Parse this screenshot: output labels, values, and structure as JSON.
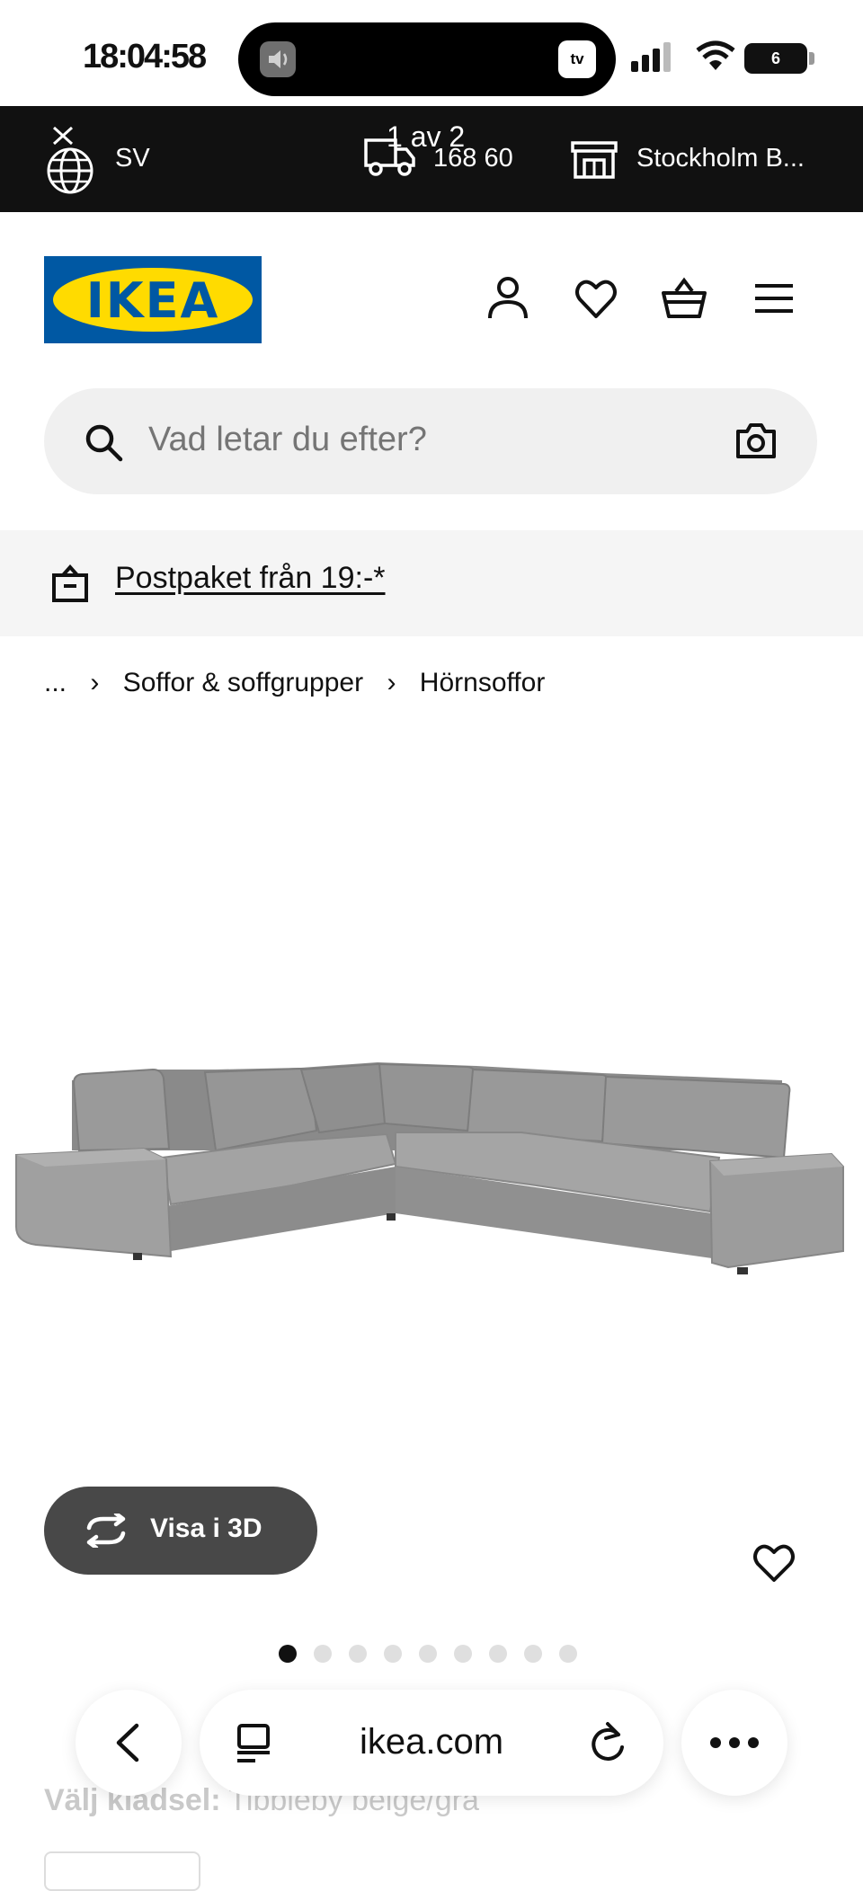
{
  "status_bar": {
    "time": "18:04:58",
    "battery": "6"
  },
  "top_bar": {
    "language": "SV",
    "zip": "168 60",
    "store": "Stockholm B...",
    "page_indicator": "1 av 2"
  },
  "header": {
    "logo_text": "IKEA"
  },
  "search": {
    "placeholder": "Vad letar du efter?"
  },
  "promo": {
    "link_text": "Postpaket från 19:-*"
  },
  "breadcrumb": {
    "ellipsis": "...",
    "items": [
      "Soffor & soffgrupper",
      "Hörnsoffor"
    ]
  },
  "product": {
    "view_3d_label": "Visa i 3D",
    "image_count": 9,
    "active_image_index": 0,
    "choose_fabric_label": "Välj klädsel:",
    "choose_fabric_value": "Tibbleby beige/grå"
  },
  "browser": {
    "url": "ikea.com"
  },
  "icons": {
    "language": "globe-icon",
    "delivery": "truck-icon",
    "store": "store-icon",
    "account": "account-icon",
    "wishlist": "heart-icon",
    "cart": "cart-icon",
    "menu": "hamburger-menu-icon",
    "search": "search-icon",
    "visual_search": "camera-icon",
    "parcel": "parcel-icon",
    "rotate": "rotate-3d-icon",
    "back": "chevron-left-icon",
    "tabs": "tabs-icon",
    "reload": "reload-icon",
    "more": "more-dots-icon"
  },
  "colors": {
    "brand_blue": "#0058a3",
    "brand_yellow": "#ffdb00",
    "top_bar": "#111111",
    "search_bg": "#f0f0f0",
    "promo_bg": "#f5f5f5",
    "sofa_gray": "#8f8f8f"
  }
}
